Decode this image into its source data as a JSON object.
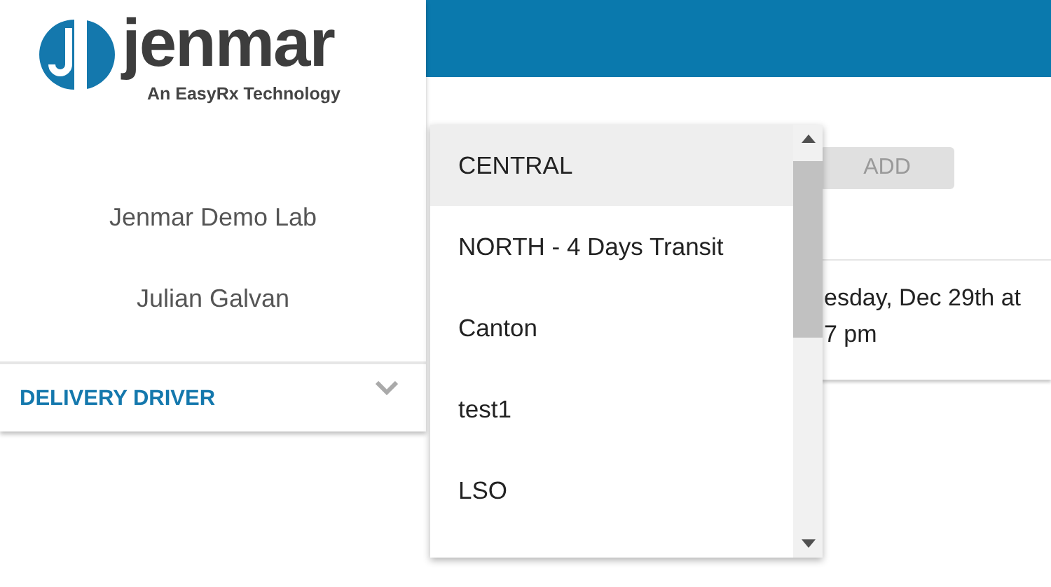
{
  "logo": {
    "wordmark": "jenmar",
    "tagline": "An EasyRx Technology"
  },
  "sidebar": {
    "lab": "Jenmar Demo Lab",
    "user": "Julian Galvan",
    "role": {
      "label": "DELIVERY DRIVER",
      "expanded": false
    }
  },
  "add_button": {
    "label": "ADD",
    "disabled": true
  },
  "card": {
    "lines": [
      "esday, Dec 29th at",
      "7 pm"
    ]
  },
  "dropdown": {
    "options": [
      {
        "label": "CENTRAL",
        "selected": true
      },
      {
        "label": "NORTH - 4 Days Transit",
        "selected": false
      },
      {
        "label": "Canton",
        "selected": false
      },
      {
        "label": "test1",
        "selected": false
      },
      {
        "label": "LSO",
        "selected": false
      }
    ]
  }
}
